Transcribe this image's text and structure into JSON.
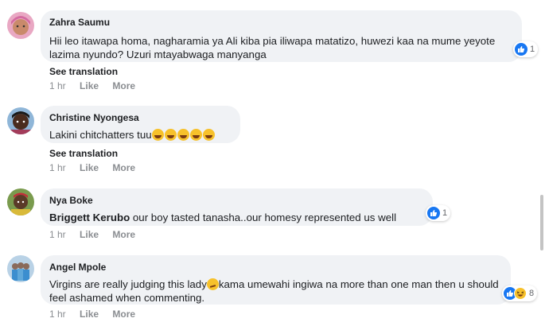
{
  "comments": [
    {
      "author": "Zahra Saumu",
      "text": "Hii leo itawapa homa, nagharamia ya Ali kiba pia iliwapa matatizo, huwezi kaa na mume yeyote lazima nyundo? Uzuri mtayabwaga manyanga",
      "see_translation": "See translation",
      "time": "1 hr",
      "like_label": "Like",
      "more_label": "More",
      "reaction_icons": [
        "like-icon"
      ],
      "reaction_count": "1"
    },
    {
      "author": "Christine Nyongesa",
      "text": "Lakini chitchatters tuu",
      "emojis": [
        "laughing-tears-emoji",
        "laughing-tears-emoji",
        "laughing-tears-emoji",
        "laughing-tears-emoji",
        "laughing-tears-emoji"
      ],
      "see_translation": "See translation",
      "time": "1 hr",
      "like_label": "Like",
      "more_label": "More"
    },
    {
      "author": "Nya Boke",
      "mention": "Briggett Kerubo",
      "text": " our boy tasted tanasha..our homesy represented us well",
      "time": "1 hr",
      "like_label": "Like",
      "more_label": "More",
      "reaction_icons": [
        "like-icon"
      ],
      "reaction_count": "1"
    },
    {
      "author": "Angel Mpole",
      "text_part1": "Virgins are really judging this lady",
      "emoji": "smirk-emoji",
      "text_part2": "kama umewahi ingiwa na more than one man then u should feel ashamed when commenting.",
      "time": "1 hr",
      "like_label": "Like",
      "more_label": "More",
      "reaction_icons": [
        "like-icon",
        "haha-icon"
      ],
      "reaction_count": "8"
    }
  ],
  "colors": {
    "bubble": "#f0f2f5",
    "like": "#1877f2",
    "meta_text": "#8a8d91"
  }
}
